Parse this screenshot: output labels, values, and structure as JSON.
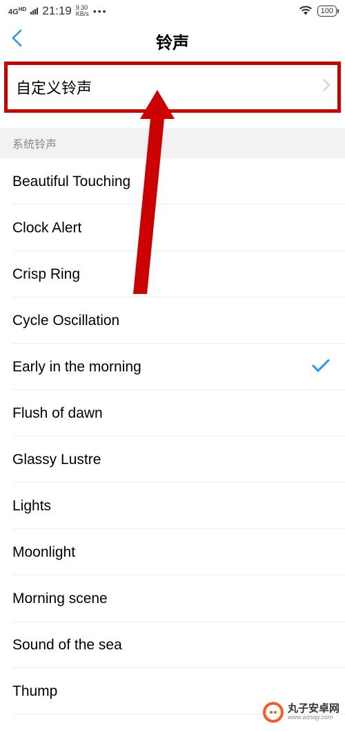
{
  "status": {
    "network": "4G",
    "hd": "HD",
    "time": "21:19",
    "speed_top": "9.30",
    "speed_bottom": "KB/s",
    "dots": "•••",
    "battery": "100"
  },
  "nav": {
    "title": "铃声"
  },
  "custom": {
    "label": "自定义铃声"
  },
  "section": {
    "header": "系统铃声"
  },
  "ringtones": [
    {
      "name": "Beautiful Touching",
      "selected": false
    },
    {
      "name": "Clock Alert",
      "selected": false
    },
    {
      "name": "Crisp Ring",
      "selected": false
    },
    {
      "name": "Cycle Oscillation",
      "selected": false
    },
    {
      "name": "Early in the morning",
      "selected": true
    },
    {
      "name": "Flush of dawn",
      "selected": false
    },
    {
      "name": "Glassy Lustre",
      "selected": false
    },
    {
      "name": "Lights",
      "selected": false
    },
    {
      "name": "Moonlight",
      "selected": false
    },
    {
      "name": "Morning scene",
      "selected": false
    },
    {
      "name": "Sound of the sea",
      "selected": false
    },
    {
      "name": "Thump",
      "selected": false
    }
  ],
  "watermark": {
    "title": "丸子安卓网",
    "url": "www.wzsqy.com"
  },
  "colors": {
    "highlight_border": "#cc0000",
    "accent": "#2196F3",
    "arrow": "#cc0000"
  }
}
